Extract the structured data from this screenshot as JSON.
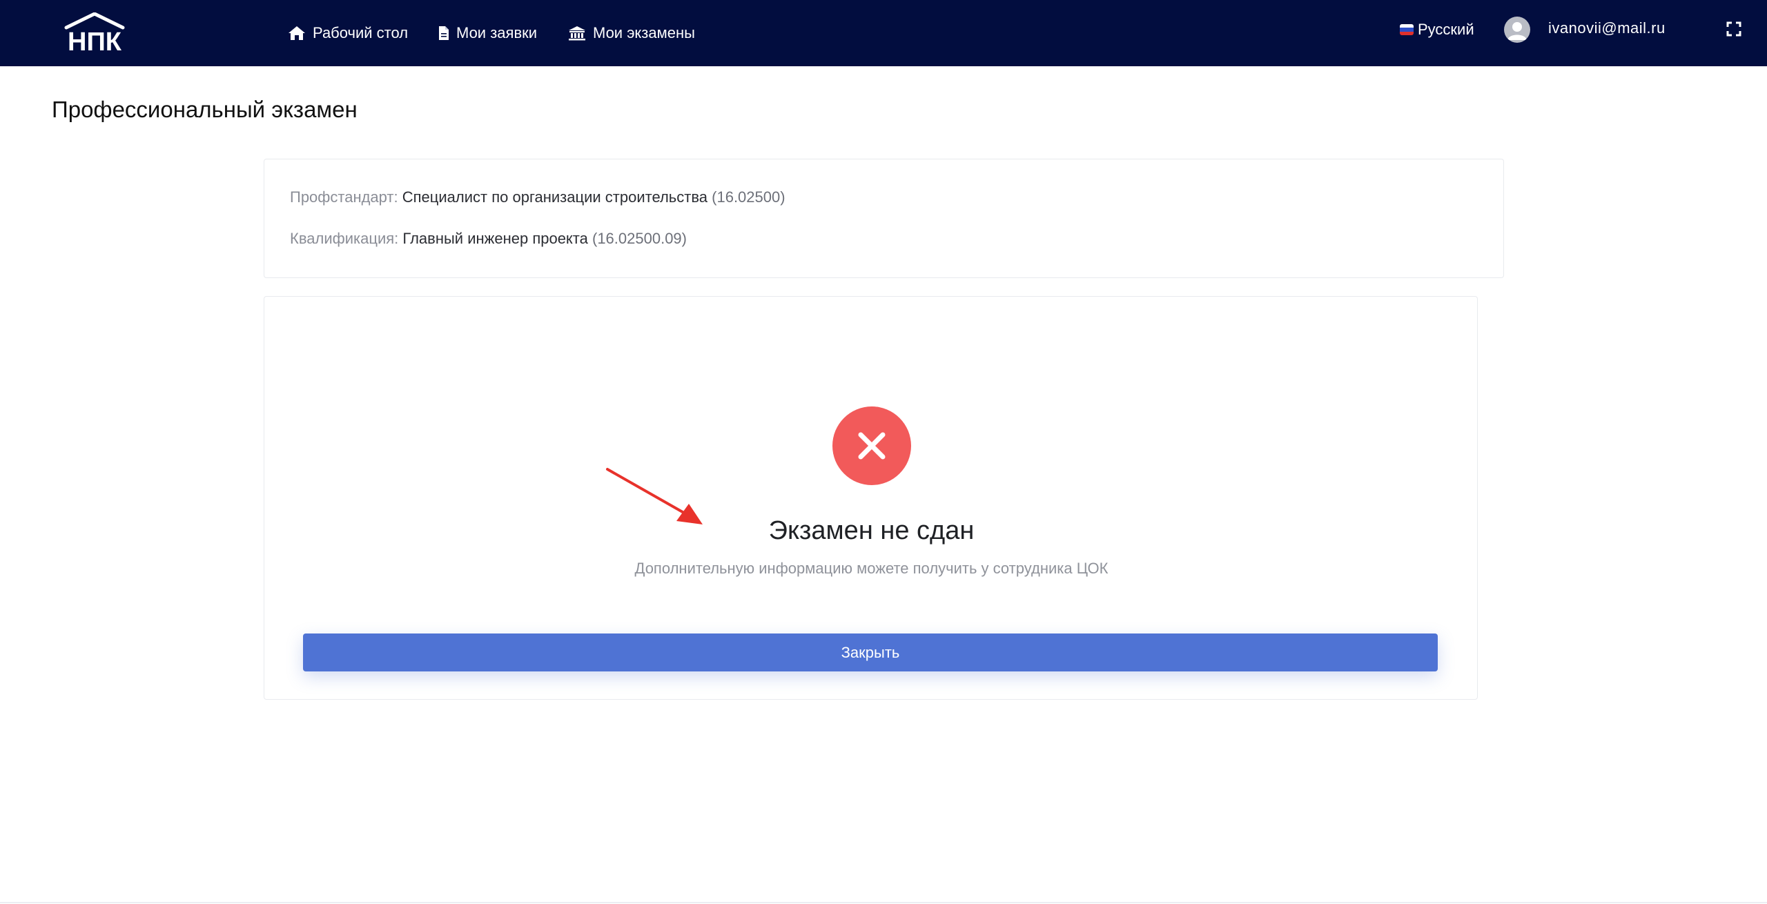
{
  "header": {
    "logo_text": "НПК",
    "nav": [
      {
        "label": "Рабочий стол",
        "icon": "home-icon"
      },
      {
        "label": "Мои заявки",
        "icon": "document-icon"
      },
      {
        "label": "Мои экзамены",
        "icon": "institution-icon"
      }
    ],
    "language": "Русский",
    "user_email": "ivanovii@mail.ru"
  },
  "page": {
    "title": "Профессиональный экзамен"
  },
  "info": {
    "standard_label": "Профстандарт:",
    "standard_value": "Специалист по организации строительства",
    "standard_code": "(16.02500)",
    "qualification_label": "Квалификация:",
    "qualification_value": "Главный инженер проекта",
    "qualification_code": "(16.02500.09)"
  },
  "result": {
    "title": "Экзамен не сдан",
    "subtitle": "Дополнительную информацию можете получить у сотрудника ЦОК",
    "close_label": "Закрыть"
  },
  "colors": {
    "navbar": "#020d3f",
    "fail": "#f25a5a",
    "primary_button": "#4f73d4",
    "annotation_arrow": "#e8322b"
  }
}
